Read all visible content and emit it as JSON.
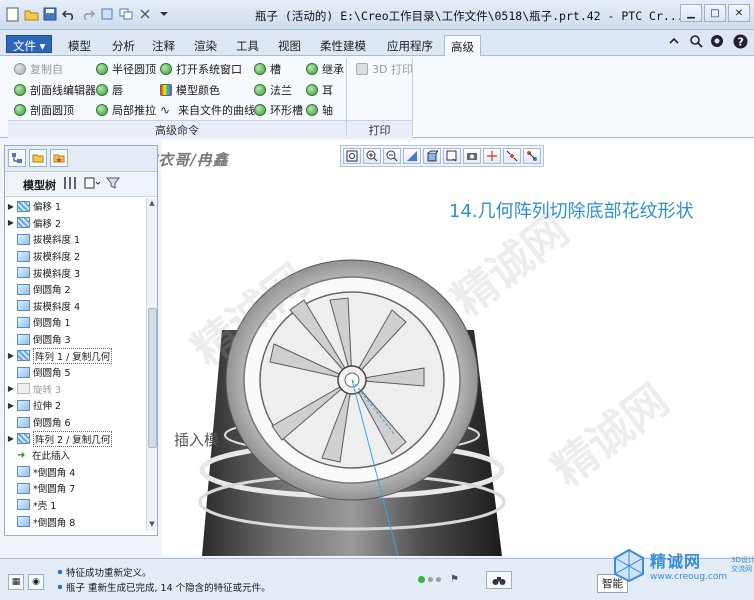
{
  "titlebar": {
    "title": "瓶子 (活动的) E:\\Creo工作目录\\工作文件\\0518\\瓶子.prt.42 - PTC Cr..."
  },
  "tabs": [
    {
      "label": "文件",
      "id": "file"
    },
    {
      "label": "模型",
      "id": "model"
    },
    {
      "label": "分析",
      "id": "analysis"
    },
    {
      "label": "注释",
      "id": "annotate"
    },
    {
      "label": "渲染",
      "id": "render"
    },
    {
      "label": "工具",
      "id": "tools"
    },
    {
      "label": "视图",
      "id": "view"
    },
    {
      "label": "柔性建模",
      "id": "flex"
    },
    {
      "label": "应用程序",
      "id": "apps"
    },
    {
      "label": "高级",
      "id": "advanced"
    }
  ],
  "file_tab_arrow": "▾",
  "ribbon": {
    "items": [
      {
        "label": "复制自",
        "dim": true
      },
      {
        "label": "半径圆顶"
      },
      {
        "label": "打开系统窗口"
      },
      {
        "label": "槽"
      },
      {
        "label": "继承"
      },
      {
        "label": "3D 打印",
        "dim": true
      },
      {
        "label": "剖面线编辑器"
      },
      {
        "label": "唇"
      },
      {
        "label": "模型颜色"
      },
      {
        "label": "法兰"
      },
      {
        "label": "耳"
      },
      {
        "label": "剖面圆顶"
      },
      {
        "label": "局部推拉"
      },
      {
        "label": "来自文件的曲线"
      },
      {
        "label": "环形槽"
      },
      {
        "label": "轴"
      }
    ],
    "groups": {
      "advanced_commands": "高级命令",
      "print": "打印"
    }
  },
  "left_panel": {
    "banner": "精诚网 破衣哥/冉鑫",
    "model_tree_label": "模型树",
    "tree": [
      {
        "label": "偏移 1",
        "expand": "▶",
        "icon": "pattern"
      },
      {
        "label": "偏移 2",
        "expand": "▶",
        "icon": "pattern"
      },
      {
        "label": "拔模斜度 1",
        "expand": "",
        "icon": "draft"
      },
      {
        "label": "拔模斜度 2",
        "expand": "",
        "icon": "draft"
      },
      {
        "label": "拔模斜度 3",
        "expand": "",
        "icon": "draft"
      },
      {
        "label": "倒圆角 2",
        "expand": "",
        "icon": "round"
      },
      {
        "label": "拔模斜度 4",
        "expand": "",
        "icon": "draft"
      },
      {
        "label": "倒圆角 1",
        "expand": "",
        "icon": "round"
      },
      {
        "label": "倒圆角 3",
        "expand": "",
        "icon": "round"
      },
      {
        "label": "阵列 1 / 复制几何",
        "expand": "▶",
        "icon": "pattern",
        "boxed": true
      },
      {
        "label": "倒圆角 5",
        "expand": "",
        "icon": "round"
      },
      {
        "label": "旋转 3",
        "expand": "▶",
        "icon": "revolve",
        "dim": true
      },
      {
        "label": "拉伸 2",
        "expand": "▶",
        "icon": "extrude"
      },
      {
        "label": "倒圆角 6",
        "expand": "",
        "icon": "round"
      },
      {
        "label": "阵列 2 / 复制几何",
        "expand": "▶",
        "icon": "pattern",
        "boxed": true
      },
      {
        "label": "在此插入",
        "expand": "",
        "icon": "insert-arrow"
      },
      {
        "label": "*倒圆角 4",
        "expand": "",
        "icon": "round"
      },
      {
        "label": "*倒圆角 7",
        "expand": "",
        "icon": "round"
      },
      {
        "label": "*壳 1",
        "expand": "",
        "icon": "shell"
      },
      {
        "label": "*倒圆角 8",
        "expand": "",
        "icon": "round"
      }
    ]
  },
  "viewport": {
    "headline": "14.几何阵列切除底部花纹形状",
    "insert_label": "插入模",
    "background_watermark": "精诚网"
  },
  "status": {
    "messages": [
      "特征成功重新定义。",
      "瓶子 重新生成已完成, 14 个隐含的特征或元件。"
    ],
    "smart_filter": "智能"
  },
  "logo": {
    "name": "精诚网",
    "url": "www.creoug.com",
    "small": "3D设计交流网"
  },
  "colors": {
    "accent": "#2f8fd6",
    "file_tab": "#2e66b8",
    "feature_icon_green": "#3d9a3a"
  }
}
